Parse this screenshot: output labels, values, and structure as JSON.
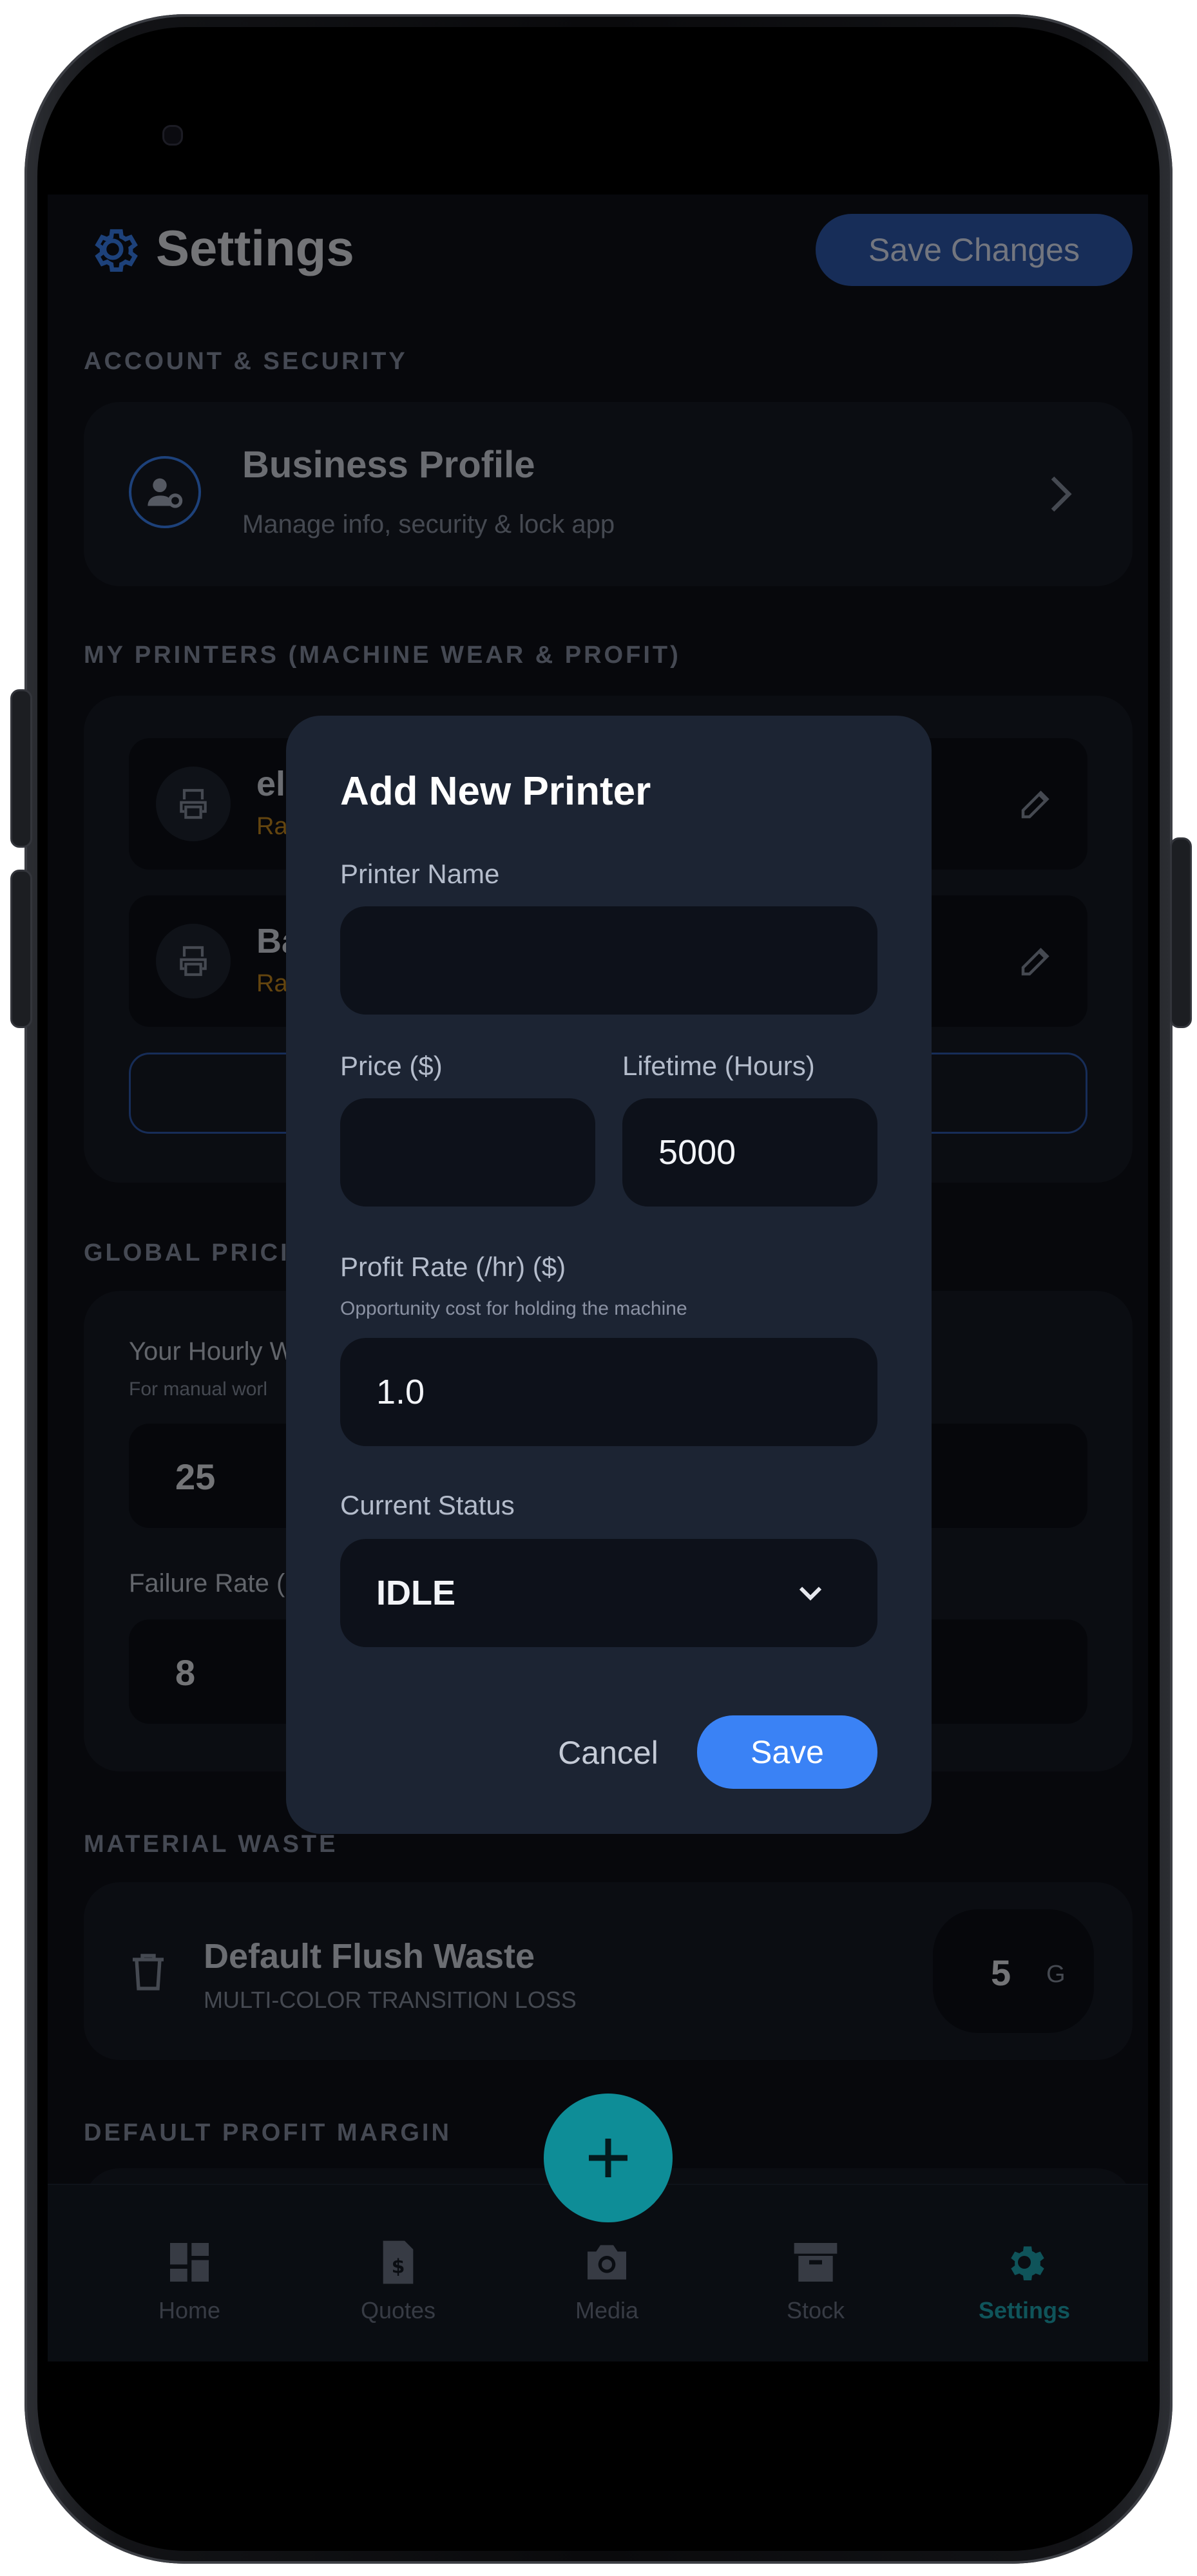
{
  "header": {
    "title": "Settings",
    "save_label": "Save Changes"
  },
  "account": {
    "section_label": "ACCOUNT & SECURITY",
    "profile_title": "Business Profile",
    "profile_sub": "Manage info, security & lock app"
  },
  "printers": {
    "section_label": "MY PRINTERS (MACHINE WEAR & PROFIT)",
    "items": [
      {
        "name_fragment": "el",
        "sub_fragment": "Ra"
      },
      {
        "name_fragment": "Ba",
        "sub_fragment": "Ra"
      }
    ]
  },
  "pricing": {
    "section_label": "GLOBAL PRICI",
    "hourly_label": "Your Hourly W",
    "hourly_sub": "For manual worl",
    "hourly_value": "25",
    "failure_label": "Failure Rate (",
    "failure_value": "8"
  },
  "waste": {
    "section_label": "MATERIAL WASTE",
    "title": "Default Flush Waste",
    "sub": "MULTI-COLOR TRANSITION LOSS",
    "value": "5",
    "unit": "G"
  },
  "margin": {
    "section_label": "DEFAULT PROFIT MARGIN"
  },
  "modal": {
    "title": "Add New Printer",
    "name_label": "Printer Name",
    "name_value": "",
    "price_label": "Price ($)",
    "price_value": "",
    "lifetime_label": "Lifetime (Hours)",
    "lifetime_value": "5000",
    "profit_label": "Profit Rate (/hr) ($)",
    "profit_sub": "Opportunity cost for holding the machine",
    "profit_value": "1.0",
    "status_label": "Current Status",
    "status_value": "IDLE",
    "cancel_label": "Cancel",
    "save_label": "Save"
  },
  "nav": {
    "items": [
      {
        "label": "Home",
        "icon": "dashboard-icon"
      },
      {
        "label": "Quotes",
        "icon": "invoice-icon"
      },
      {
        "label": "Media",
        "icon": "camera-icon"
      },
      {
        "label": "Stock",
        "icon": "archive-icon"
      },
      {
        "label": "Settings",
        "icon": "gear-icon"
      }
    ],
    "active": "Settings"
  },
  "colors": {
    "accent": "#3a82f5",
    "fab": "#0e8d97",
    "warning": "#c98a1e",
    "active_nav": "#1ea8b5"
  }
}
